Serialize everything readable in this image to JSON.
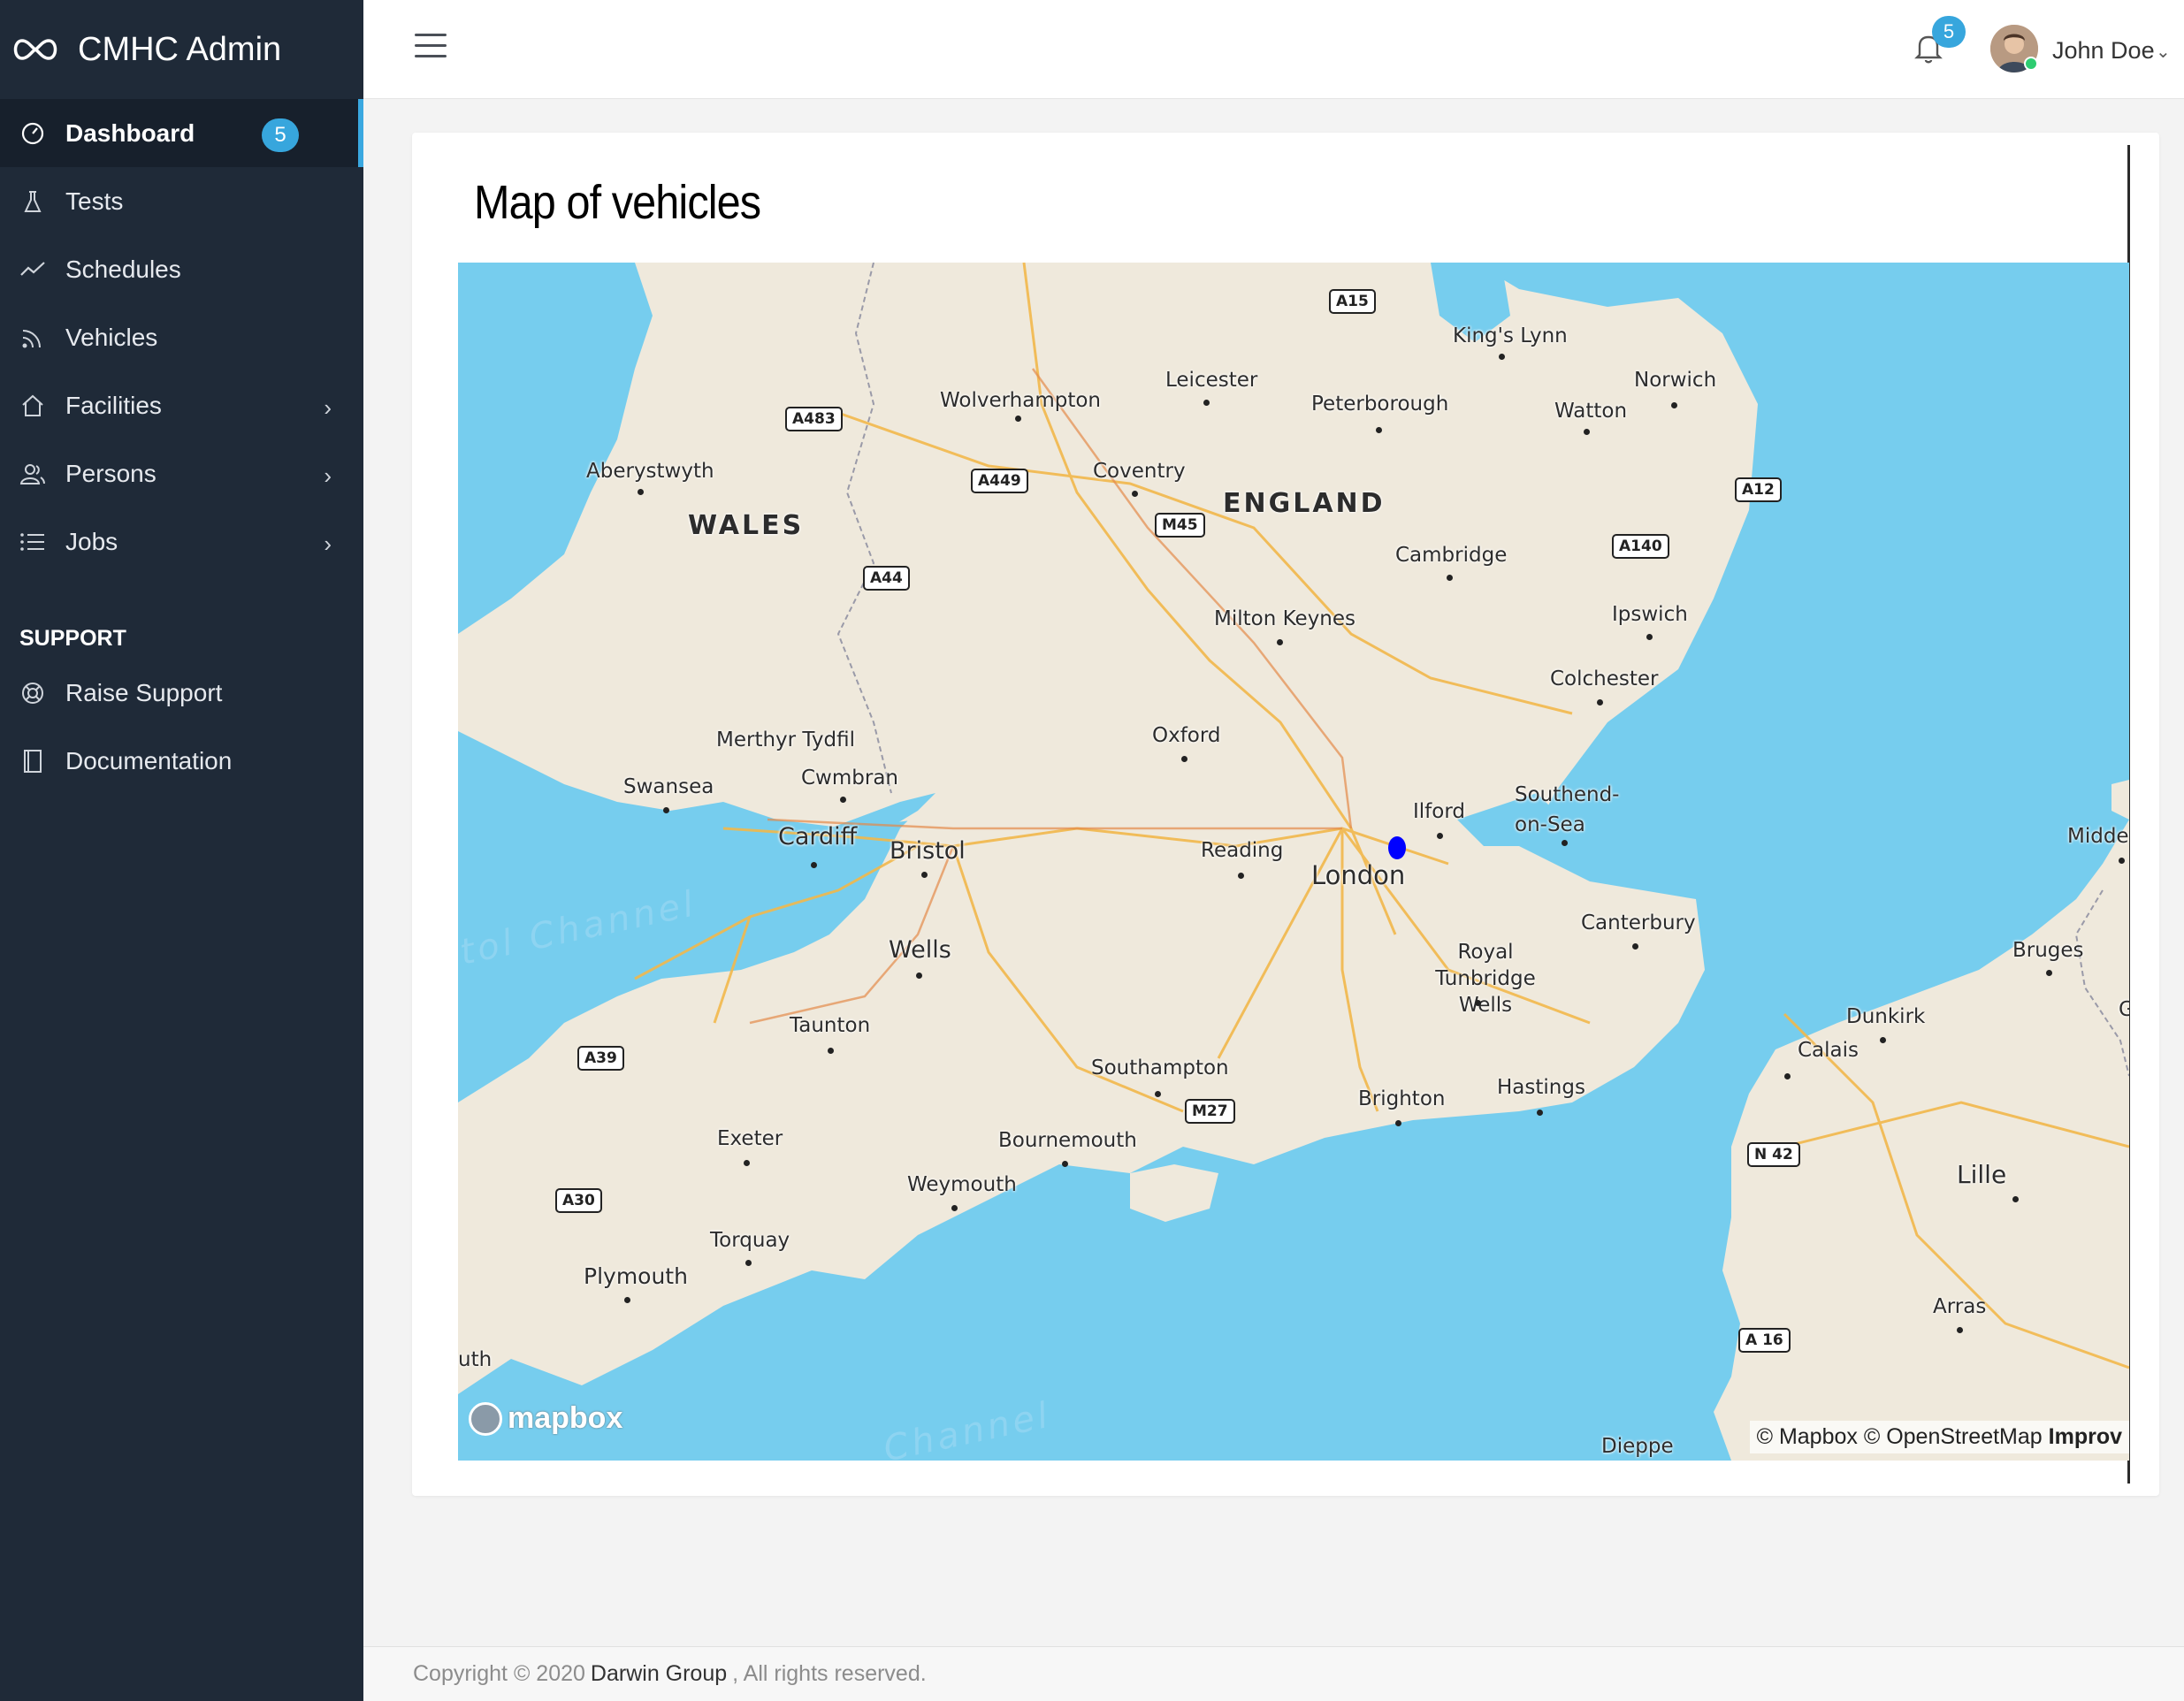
{
  "app": {
    "title": "CMHC Admin",
    "logo_icon": "infinity-icon"
  },
  "sidebar": {
    "items": [
      {
        "label": "Dashboard",
        "icon": "dashboard-icon",
        "badge": "5",
        "active": true
      },
      {
        "label": "Tests",
        "icon": "flask-icon"
      },
      {
        "label": "Schedules",
        "icon": "line-chart-icon"
      },
      {
        "label": "Vehicles",
        "icon": "signal-icon"
      },
      {
        "label": "Facilities",
        "icon": "home-icon",
        "has_children": true
      },
      {
        "label": "Persons",
        "icon": "people-icon",
        "has_children": true
      },
      {
        "label": "Jobs",
        "icon": "list-icon",
        "has_children": true
      }
    ],
    "support_heading": "SUPPORT",
    "support_items": [
      {
        "label": "Raise Support",
        "icon": "lifebuoy-icon"
      },
      {
        "label": "Documentation",
        "icon": "book-icon"
      }
    ]
  },
  "topbar": {
    "notifications_count": "5",
    "user_name": "John Doe"
  },
  "card": {
    "title": "Map of vehicles"
  },
  "map": {
    "region_labels": [
      "WALES",
      "ENGLAND"
    ],
    "cities": [
      "Leicester",
      "King's Lynn",
      "Norwich",
      "Wolverhampton",
      "Peterborough",
      "Watton",
      "Aberystwyth",
      "Coventry",
      "Cambridge",
      "Ipswich",
      "Milton Keynes",
      "Colchester",
      "Merthyr Tydfil",
      "Cwmbran",
      "Oxford",
      "Swansea",
      "Cardiff",
      "Bristol",
      "Reading",
      "Ilford",
      "Southend-on-Sea",
      "London",
      "Middel",
      "Canterbury",
      "Wells",
      "Royal Tunbridge Wells",
      "Bruges",
      "Taunton",
      "Dunkirk",
      "Calais",
      "Southampton",
      "Brighton",
      "Hastings",
      "Exeter",
      "Bournemouth",
      "Weymouth",
      "Lille",
      "Torquay",
      "Plymouth",
      "Arras",
      "Dieppe",
      "uth",
      "G"
    ],
    "roads": [
      "A15",
      "A483",
      "A449",
      "M45",
      "A12",
      "A140",
      "A44",
      "A39",
      "M27",
      "N 42",
      "A30",
      "A 16"
    ],
    "sea_labels": [
      "tol Channel",
      "Channel"
    ],
    "vehicle_count": 1,
    "logo_text": "mapbox",
    "attribution": "© Mapbox © OpenStreetMap",
    "attribution_link": "Improv"
  },
  "footer": {
    "copyright": "Copyright © 2020",
    "company": "Darwin Group",
    "rights": ", All rights reserved."
  },
  "colors": {
    "sidebar_bg": "#1f2a38",
    "accent": "#37a6dd",
    "sea": "#76cdee",
    "land": "#efe9dc",
    "marker": "#0000ff"
  }
}
